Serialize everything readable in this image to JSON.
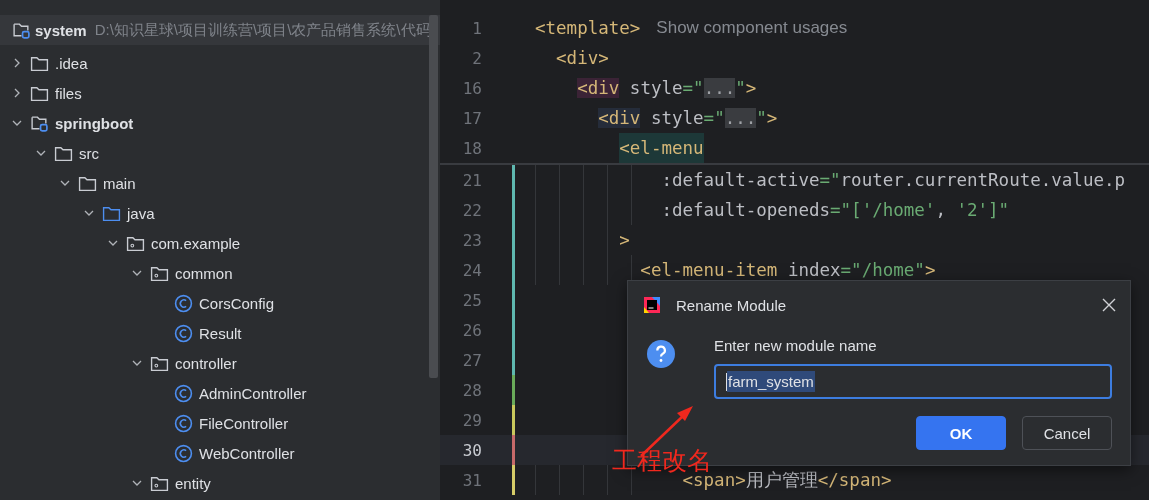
{
  "sidebar": {
    "project": {
      "name": "system",
      "path": "D:\\知识星球\\项目训练营\\项目\\农产品销售系统\\代码"
    },
    "items": [
      {
        "label": ".idea",
        "kind": "folder",
        "expanded": false
      },
      {
        "label": "files",
        "kind": "folder",
        "expanded": false
      },
      {
        "label": "springboot",
        "kind": "module",
        "expanded": true,
        "children": [
          {
            "label": "src",
            "kind": "folder",
            "expanded": true,
            "children": [
              {
                "label": "main",
                "kind": "folder",
                "expanded": true,
                "children": [
                  {
                    "label": "java",
                    "kind": "source",
                    "expanded": true,
                    "children": [
                      {
                        "label": "com.example",
                        "kind": "package",
                        "expanded": true,
                        "children": [
                          {
                            "label": "common",
                            "kind": "package",
                            "expanded": true,
                            "children": [
                              {
                                "label": "CorsConfig",
                                "kind": "class"
                              },
                              {
                                "label": "Result",
                                "kind": "class"
                              }
                            ]
                          },
                          {
                            "label": "controller",
                            "kind": "package",
                            "expanded": true,
                            "children": [
                              {
                                "label": "AdminController",
                                "kind": "class"
                              },
                              {
                                "label": "FileController",
                                "kind": "class"
                              },
                              {
                                "label": "WebController",
                                "kind": "class"
                              }
                            ]
                          },
                          {
                            "label": "entity",
                            "kind": "package",
                            "expanded": true
                          }
                        ]
                      }
                    ]
                  }
                ]
              }
            ]
          }
        ]
      }
    ]
  },
  "editor": {
    "sticky_lines": [
      {
        "number": "1",
        "segments": [
          {
            "text": "<template>",
            "kind": "tag"
          },
          {
            "text": "Show component usages",
            "kind": "hint"
          }
        ]
      },
      {
        "number": "2",
        "segments": [
          {
            "text": "  <div>",
            "kind": "tag"
          }
        ]
      },
      {
        "number": "16",
        "segments": [
          {
            "text": "    <div",
            "kind": "match1"
          },
          {
            "text": " style",
            "kind": "attr"
          },
          {
            "text": "=\"",
            "kind": "str"
          },
          {
            "text": "...",
            "kind": "fold"
          },
          {
            "text": "\"",
            "kind": "str"
          },
          {
            "text": ">",
            "kind": "tag"
          }
        ]
      },
      {
        "number": "17",
        "segments": [
          {
            "text": "      <div",
            "kind": "match2"
          },
          {
            "text": " style",
            "kind": "attr"
          },
          {
            "text": "=\"",
            "kind": "str"
          },
          {
            "text": "...",
            "kind": "fold"
          },
          {
            "text": "\"",
            "kind": "str"
          },
          {
            "text": ">",
            "kind": "tag"
          }
        ]
      },
      {
        "number": "18",
        "segments": [
          {
            "text": "        <el-menu",
            "kind": "match3"
          }
        ]
      }
    ],
    "lines": [
      {
        "number": "21",
        "color": "#5fb8b0",
        "current": false,
        "segments": [
          {
            "text": "            :default-active",
            "kind": "attr"
          },
          {
            "text": "=\"",
            "kind": "str"
          },
          {
            "text": "router.currentRoute.value.p",
            "kind": "text"
          }
        ]
      },
      {
        "number": "22",
        "color": "#5fb8b0",
        "current": false,
        "segments": [
          {
            "text": "            :default-openeds",
            "kind": "attr"
          },
          {
            "text": "=\"[",
            "kind": "str"
          },
          {
            "text": "'/home'",
            "kind": "str2"
          },
          {
            "text": ", ",
            "kind": "text"
          },
          {
            "text": "'2'",
            "kind": "str2"
          },
          {
            "text": "]\"",
            "kind": "str"
          }
        ]
      },
      {
        "number": "23",
        "color": "#5fb8b0",
        "current": false,
        "segments": [
          {
            "text": "        >",
            "kind": "tag"
          }
        ]
      },
      {
        "number": "24",
        "color": "#5fb8b0",
        "current": false,
        "segments": [
          {
            "text": "          <el-menu-item",
            "kind": "tag"
          },
          {
            "text": " index",
            "kind": "attr"
          },
          {
            "text": "=\"",
            "kind": "str"
          },
          {
            "text": "/home",
            "kind": "str2"
          },
          {
            "text": "\"",
            "kind": "str"
          },
          {
            "text": ">",
            "kind": "tag"
          }
        ]
      },
      {
        "number": "25",
        "color": "#5fb8b0",
        "current": false
      },
      {
        "number": "26",
        "color": "#5fb8b0",
        "current": false
      },
      {
        "number": "27",
        "color": "#5fb8b0",
        "current": false
      },
      {
        "number": "28",
        "color": "#6aab5a",
        "current": false
      },
      {
        "number": "29",
        "color": "#c9c85c",
        "current": false
      },
      {
        "number": "30",
        "color": "#c76a6a",
        "current": true
      },
      {
        "number": "31",
        "color": "#d6cc68",
        "current": false,
        "segments": [
          {
            "text": "              <span>",
            "kind": "tag"
          },
          {
            "text": "用户管理",
            "kind": "text"
          },
          {
            "text": "</span>",
            "kind": "tag"
          }
        ]
      }
    ]
  },
  "dialog": {
    "title": "Rename Module",
    "prompt": "Enter new module name",
    "value": "farm_system",
    "buttons": [
      {
        "label": "OK",
        "kind": "primary"
      },
      {
        "label": "Cancel",
        "kind": "secondary"
      }
    ]
  },
  "annotation": {
    "text": "工程改名"
  }
}
